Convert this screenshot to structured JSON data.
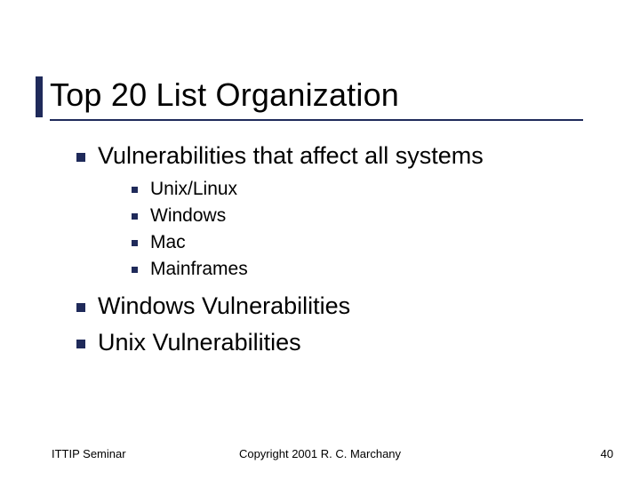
{
  "title": "Top 20 List Organization",
  "bullets": [
    {
      "text": "Vulnerabilities that affect all systems",
      "sub": [
        "Unix/Linux",
        "Windows",
        "Mac",
        "Mainframes"
      ]
    },
    {
      "text": "Windows Vulnerabilities"
    },
    {
      "text": "Unix Vulnerabilities"
    }
  ],
  "footer": {
    "left": "ITTIP Seminar",
    "center": "Copyright 2001 R. C. Marchany",
    "right": "40"
  }
}
